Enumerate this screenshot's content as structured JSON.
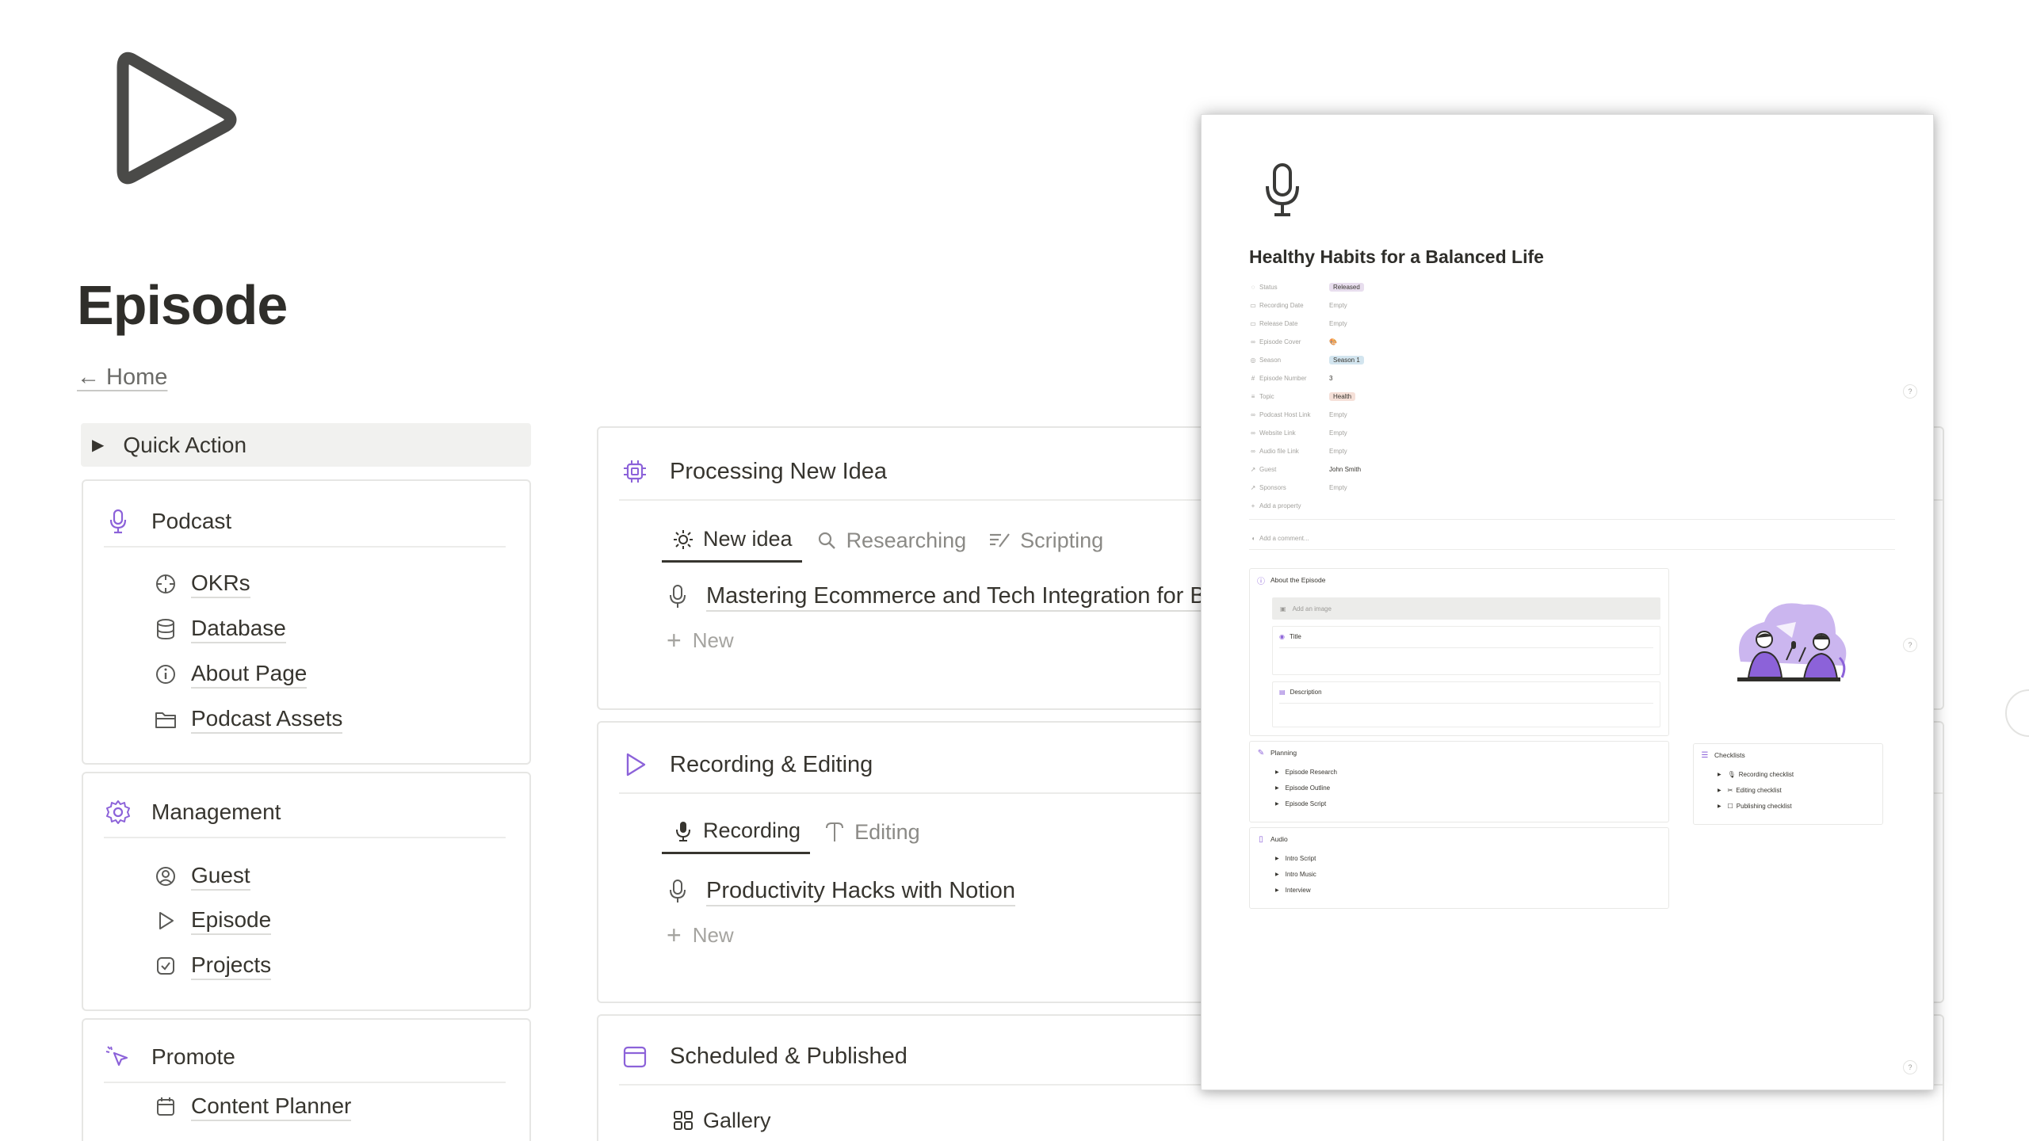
{
  "page": {
    "title": "Episode",
    "home_link": "← Home",
    "quick_action": "Quick Action"
  },
  "sidebar": {
    "podcast": {
      "title": "Podcast",
      "items": [
        {
          "label": "OKRs",
          "icon": "crosshair-icon"
        },
        {
          "label": "Database",
          "icon": "database-icon"
        },
        {
          "label": "About Page",
          "icon": "info-icon"
        },
        {
          "label": "Podcast Assets",
          "icon": "folder-icon"
        }
      ]
    },
    "management": {
      "title": "Management",
      "items": [
        {
          "label": "Guest",
          "icon": "user-circle-icon"
        },
        {
          "label": "Episode",
          "icon": "play-icon"
        },
        {
          "label": "Projects",
          "icon": "checkbox-icon"
        }
      ]
    },
    "promote": {
      "title": "Promote",
      "items": [
        {
          "label": "Content Planner",
          "icon": "calendar-icon"
        }
      ]
    }
  },
  "main": {
    "processing": {
      "title": "Processing New Idea",
      "tabs": [
        "New idea",
        "Researching",
        "Scripting"
      ],
      "rows": [
        "Mastering Ecommerce and Tech Integration for B"
      ],
      "new_label": "New"
    },
    "recording": {
      "title": "Recording & Editing",
      "tabs": [
        "Recording",
        "Editing"
      ],
      "rows": [
        "Productivity Hacks with Notion"
      ],
      "new_label": "New"
    },
    "scheduled": {
      "title": "Scheduled & Published",
      "tabs": [
        "Gallery"
      ]
    }
  },
  "preview": {
    "title": "Healthy Habits for a Balanced Life",
    "properties": [
      {
        "label": "Status",
        "value": "Released",
        "kind": "tag",
        "color": "#e8deee"
      },
      {
        "label": "Recording Date",
        "value": "Empty",
        "kind": "empty"
      },
      {
        "label": "Release Date",
        "value": "Empty",
        "kind": "empty"
      },
      {
        "label": "Episode Cover",
        "value": "🎨",
        "kind": "text"
      },
      {
        "label": "Season",
        "value": "Season 1",
        "kind": "tag",
        "color": "#d3e5ef"
      },
      {
        "label": "Episode Number",
        "value": "3",
        "kind": "text"
      },
      {
        "label": "Topic",
        "value": "Health",
        "kind": "tag",
        "color": "#f5e0d8"
      },
      {
        "label": "Podcast Host Link",
        "value": "Empty",
        "kind": "empty"
      },
      {
        "label": "Website Link",
        "value": "Empty",
        "kind": "empty"
      },
      {
        "label": "Audio file Link",
        "value": "Empty",
        "kind": "empty"
      },
      {
        "label": "Guest",
        "value": "John Smith",
        "kind": "text"
      },
      {
        "label": "Sponsors",
        "value": "Empty",
        "kind": "empty"
      }
    ],
    "add_property": "Add a property",
    "add_comment": "Add a comment...",
    "about": {
      "title": "About the Episode",
      "add_image": "Add an image",
      "title_label": "Title",
      "description_label": "Description"
    },
    "planning": {
      "title": "Planning",
      "items": [
        "Episode Research",
        "Episode Outline",
        "Episode Script"
      ]
    },
    "audio": {
      "title": "Audio",
      "items": [
        "Intro Script",
        "Intro Music",
        "Interview"
      ]
    },
    "checklists": {
      "title": "Checklists",
      "items": [
        "Recording checklist",
        "Editing checklist",
        "Publishing checklist"
      ]
    },
    "help": "?"
  },
  "colors": {
    "accent": "#8c62d9",
    "text": "#37352f",
    "muted": "#9b9a97",
    "border": "#e6e6e4"
  }
}
